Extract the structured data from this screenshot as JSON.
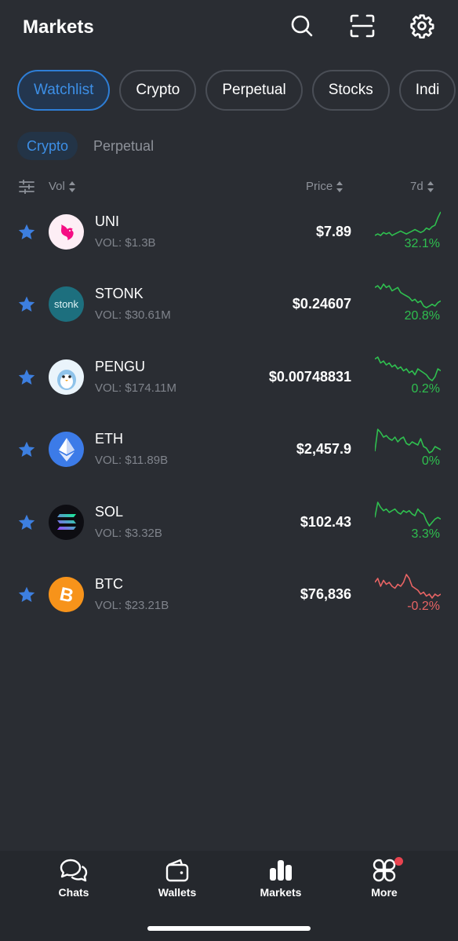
{
  "header": {
    "title": "Markets",
    "icons": [
      "search-icon",
      "scan-icon",
      "gear-icon"
    ]
  },
  "category_tabs": [
    "Watchlist",
    "Crypto",
    "Perpetual",
    "Stocks",
    "Indi"
  ],
  "active_category": "Watchlist",
  "sub_tabs": [
    "Crypto",
    "Perpetual"
  ],
  "active_sub_tab": "Crypto",
  "columns": {
    "vol": "Vol",
    "price": "Price",
    "change": "7d"
  },
  "colors": {
    "background": "#2a2d33",
    "accent": "#3d8fe6",
    "up": "#2fbf4f",
    "down": "#e86464",
    "star": "#3d7fe0"
  },
  "assets": [
    {
      "symbol": "UNI",
      "volume": "VOL: $1.3B",
      "price": "$7.89",
      "change": "32.1%",
      "trend": "up",
      "spark": [
        6,
        7,
        6,
        8,
        7,
        8,
        6,
        7,
        8,
        9,
        8,
        7,
        8,
        9,
        10,
        9,
        8,
        9,
        11,
        10,
        12,
        13,
        18,
        22
      ]
    },
    {
      "symbol": "STONK",
      "volume": "VOL: $30.61M",
      "price": "$0.24607",
      "change": "20.8%",
      "trend": "up",
      "spark": [
        20,
        21,
        19,
        22,
        20,
        21,
        18,
        19,
        20,
        17,
        16,
        15,
        14,
        12,
        13,
        11,
        12,
        9,
        8,
        9,
        10,
        9,
        11,
        12
      ]
    },
    {
      "symbol": "PENGU",
      "volume": "VOL: $174.11M",
      "price": "$0.00748831",
      "change": "0.2%",
      "trend": "up",
      "spark": [
        18,
        19,
        16,
        17,
        15,
        16,
        14,
        15,
        13,
        14,
        12,
        13,
        11,
        12,
        10,
        13,
        12,
        11,
        10,
        8,
        7,
        9,
        13,
        12
      ]
    },
    {
      "symbol": "ETH",
      "volume": "VOL: $11.89B",
      "price": "$2,457.9",
      "change": "0%",
      "trend": "up",
      "spark": [
        6,
        20,
        18,
        15,
        16,
        14,
        13,
        15,
        12,
        14,
        15,
        11,
        10,
        12,
        11,
        10,
        14,
        9,
        8,
        5,
        6,
        9,
        8,
        7
      ]
    },
    {
      "symbol": "SOL",
      "volume": "VOL: $3.32B",
      "price": "$102.43",
      "change": "3.3%",
      "trend": "up",
      "spark": [
        10,
        19,
        16,
        14,
        15,
        13,
        14,
        15,
        13,
        12,
        14,
        13,
        14,
        12,
        11,
        15,
        13,
        12,
        8,
        5,
        7,
        9,
        10,
        9
      ]
    },
    {
      "symbol": "BTC",
      "volume": "VOL: $23.21B",
      "price": "$76,836",
      "change": "-0.2%",
      "trend": "down",
      "spark": [
        14,
        16,
        12,
        15,
        13,
        14,
        12,
        11,
        13,
        12,
        14,
        18,
        16,
        12,
        11,
        10,
        8,
        9,
        7,
        8,
        6,
        8,
        7,
        8
      ]
    }
  ],
  "tabbar": {
    "items": [
      {
        "label": "Chats",
        "icon": "chat-bubbles-icon"
      },
      {
        "label": "Wallets",
        "icon": "wallet-icon"
      },
      {
        "label": "Markets",
        "icon": "bar-chart-icon"
      },
      {
        "label": "More",
        "icon": "grid-more-icon"
      }
    ]
  }
}
